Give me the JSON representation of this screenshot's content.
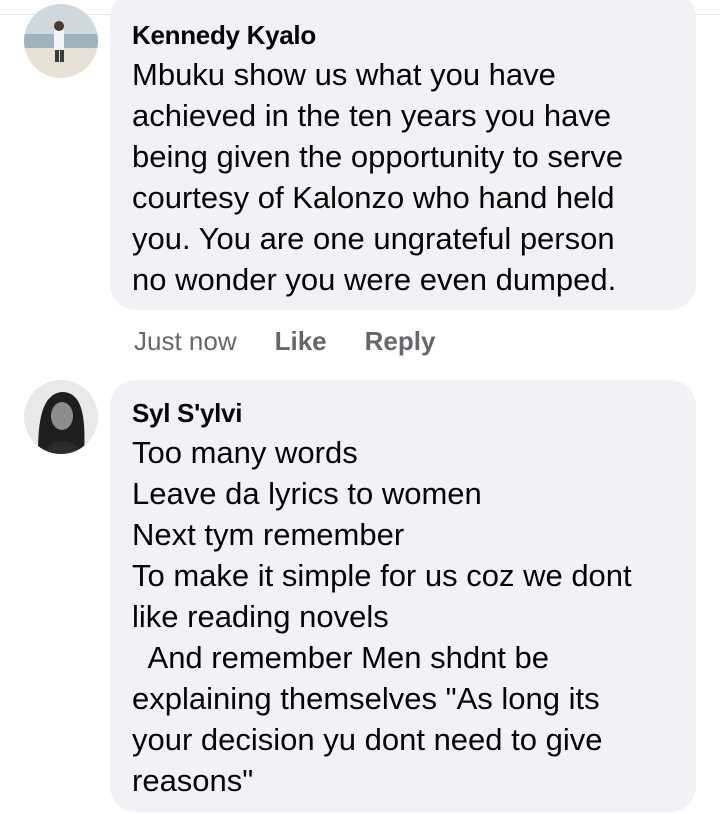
{
  "comments": [
    {
      "author": "Kennedy Kyalo",
      "lines": [
        "Mbuku show us what you have",
        "achieved in the ten years you have",
        "being given the opportunity to serve",
        "courtesy of Kalonzo who hand held",
        "you. You are one ungrateful person",
        "no wonder you were even dumped."
      ],
      "timestamp": "Just now",
      "like_label": "Like",
      "reply_label": "Reply"
    },
    {
      "author": "Syl S'ylvi",
      "lines": [
        "Too many words",
        "Leave da lyrics to women",
        "Next tym remember",
        "To make it simple for us coz we dont",
        "like reading novels",
        "  And remember Men shdnt be",
        "explaining themselves \"As long its",
        "your decision yu dont need to give",
        "reasons\""
      ]
    }
  ],
  "colors": {
    "bubble": "#f0f2f5",
    "text": "#050505",
    "meta": "#65676b"
  }
}
